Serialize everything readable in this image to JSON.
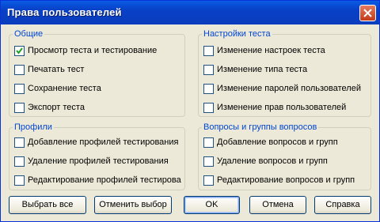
{
  "window": {
    "title": "Права пользователей"
  },
  "groups": {
    "general": {
      "title": "Общие",
      "items": [
        {
          "label": "Просмотр теста и тестирование",
          "checked": true
        },
        {
          "label": "Печатать тест",
          "checked": false
        },
        {
          "label": "Сохранение теста",
          "checked": false
        },
        {
          "label": "Экспорт теста",
          "checked": false
        }
      ]
    },
    "test_settings": {
      "title": "Настройки теста",
      "items": [
        {
          "label": "Изменение настроек теста",
          "checked": false
        },
        {
          "label": "Изменение типа теста",
          "checked": false
        },
        {
          "label": "Изменение паролей пользователей",
          "checked": false
        },
        {
          "label": "Изменение прав пользователей",
          "checked": false
        }
      ]
    },
    "profiles": {
      "title": "Профили",
      "items": [
        {
          "label": "Добавление профилей тестирования",
          "checked": false
        },
        {
          "label": "Удаление профилей тестирования",
          "checked": false
        },
        {
          "label": "Редактирование профилей тестирова",
          "checked": false
        }
      ]
    },
    "questions": {
      "title": "Вопросы и группы вопросов",
      "items": [
        {
          "label": "Добавление вопросов и групп",
          "checked": false
        },
        {
          "label": "Удаление вопросов и групп",
          "checked": false
        },
        {
          "label": "Редактирование вопросов и групп",
          "checked": false
        }
      ]
    }
  },
  "buttons": {
    "select_all": "Выбрать все",
    "deselect": "Отменить выбор",
    "ok": "OK",
    "cancel": "Отмена",
    "help": "Справка"
  },
  "colors": {
    "title_bar": "#0a5be3",
    "group_title": "#0046d5",
    "background": "#ece9d8",
    "close_button": "#d2512f"
  }
}
